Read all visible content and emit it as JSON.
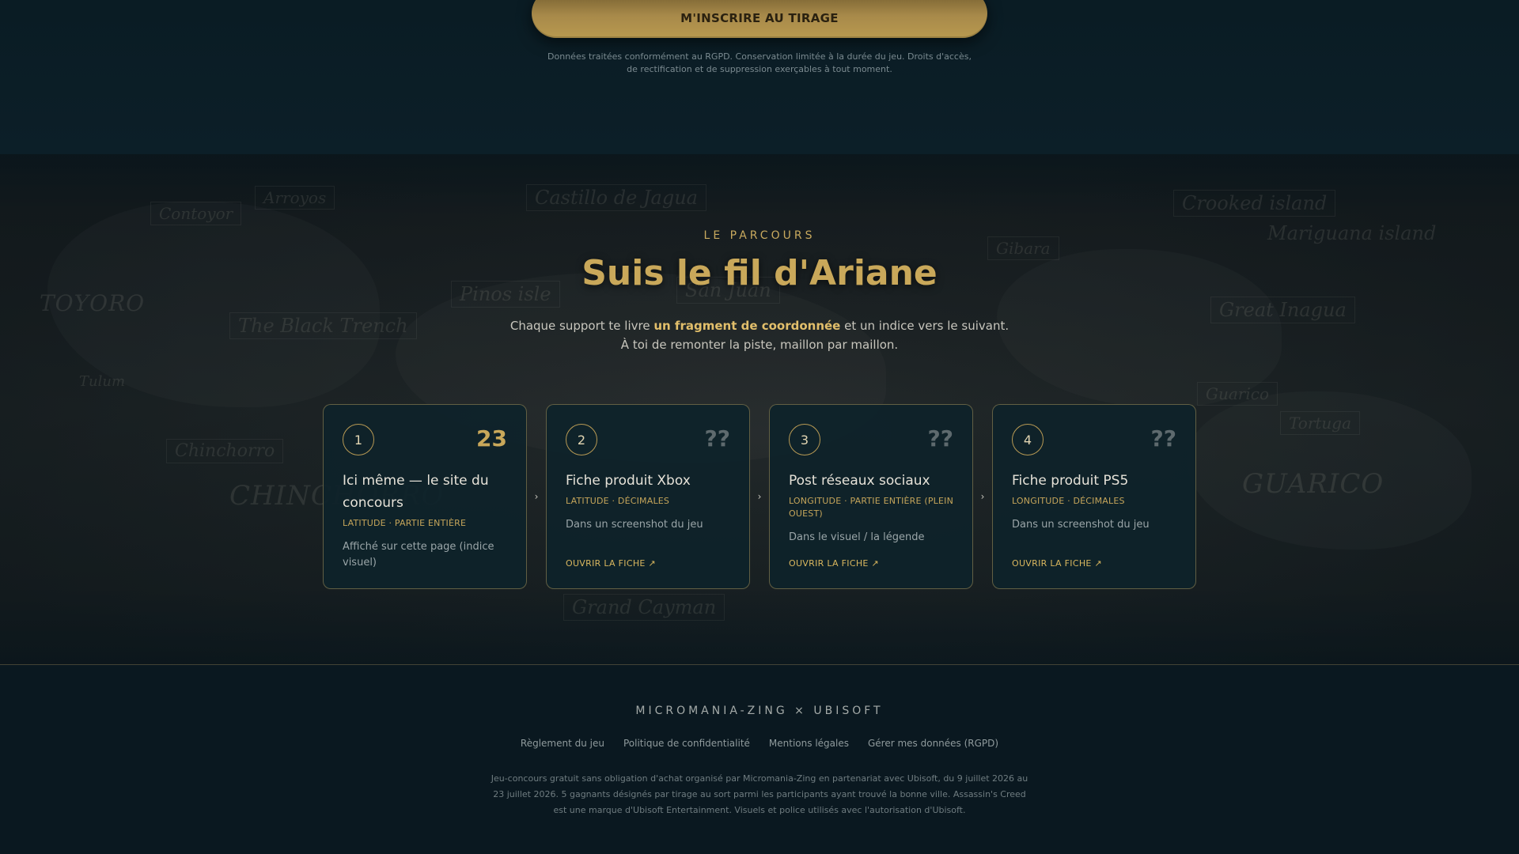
{
  "cta": {
    "label": "M'INSCRIRE AU TIRAGE",
    "gdpr_note": "Données traitées conformément au RGPD. Conservation limitée à la durée du jeu. Droits d'accès, de rectification et de suppression exerçables à tout moment."
  },
  "map_labels": [
    "Castillo de Jagua",
    "Arroyos",
    "Contoyor",
    "Pinos isle",
    "San Juan",
    "The Black Trench",
    "Crooked island",
    "Mariguana island",
    "Great Inagua",
    "Gibara",
    "Tortuga",
    "Chinchorro",
    "CHINCHORRO",
    "Grand Cayman",
    "Guarico",
    "GUARICO",
    "TOYORO",
    "Tulum"
  ],
  "parcours": {
    "kicker": "LE PARCOURS",
    "title": "Suis le fil d'Ariane",
    "intro_before": "Chaque support te livre ",
    "intro_bold": "un fragment de coordonnée",
    "intro_after": " et un indice vers le suivant. À toi de remonter la piste, maillon par maillon."
  },
  "cards": [
    {
      "number": "1",
      "code": "23",
      "title": "Ici même — le site du concours",
      "tag": "LATITUDE · PARTIE ENTIÈRE",
      "desc": "Affiché sur cette page (indice visuel)",
      "link": ""
    },
    {
      "number": "2",
      "code": "??",
      "title": "Fiche produit Xbox",
      "tag": "LATITUDE · DÉCIMALES",
      "desc": "Dans un screenshot du jeu",
      "link": "OUVRIR LA FICHE ↗"
    },
    {
      "number": "3",
      "code": "??",
      "title": "Post réseaux sociaux",
      "tag": "LONGITUDE · PARTIE ENTIÈRE (PLEIN OUEST)",
      "desc": "Dans le visuel / la légende",
      "link": "OUVRIR LA FICHE ↗"
    },
    {
      "number": "4",
      "code": "??",
      "title": "Fiche produit PS5",
      "tag": "LONGITUDE · DÉCIMALES",
      "desc": "Dans un screenshot du jeu",
      "link": "OUVRIR LA FICHE ↗"
    }
  ],
  "arrow_glyph": "›",
  "footer": {
    "brand": "MICROMANIA-ZING × UBISOFT",
    "links": [
      "Règlement du jeu",
      "Politique de confidentialité",
      "Mentions légales",
      "Gérer mes données (RGPD)"
    ],
    "legal": "Jeu-concours gratuit sans obligation d'achat organisé par Micromania-Zing en partenariat avec Ubisoft, du 9 juillet 2026 au 23 juillet 2026. 5 gagnants désignés par tirage au sort parmi les participants ayant trouvé la bonne ville. Assassin's Creed est une marque d'Ubisoft Entertainment. Visuels et police utilisés avec l'autorisation d'Ubisoft."
  },
  "colors": {
    "accent_gold": "#c9a85a",
    "background": "#0b1c24",
    "card_bg": "#0e222a"
  }
}
